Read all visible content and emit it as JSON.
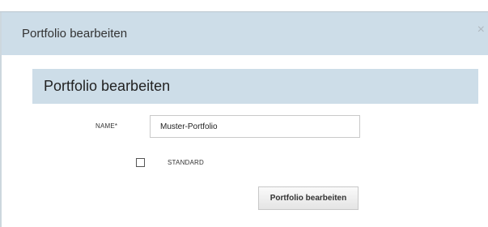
{
  "dialog": {
    "title": "Portfolio bearbeiten",
    "close_icon": "close-icon",
    "close_glyph": "×"
  },
  "form": {
    "section_title": "Portfolio bearbeiten",
    "name_label": "NAME*",
    "name_value": "Muster-Portfolio",
    "standard_label": "STANDARD",
    "standard_checked": false,
    "submit_label": "Portfolio bearbeiten"
  }
}
